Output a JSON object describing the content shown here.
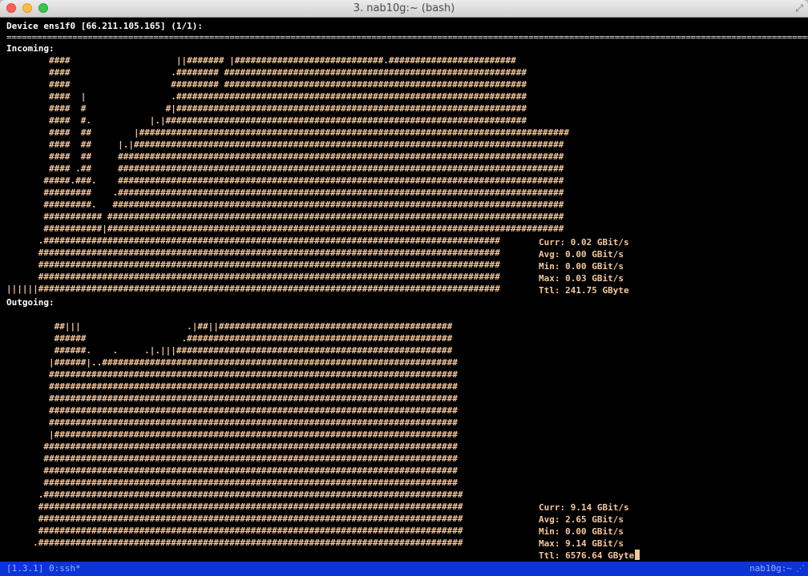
{
  "window": {
    "title": "3. nab10g:~ (bash)",
    "fullscreen_glyph": "⤢"
  },
  "terminal": {
    "header": "Device ens1f0 [66.211.105.165] (1/1):",
    "separator": "====================================================================================================================================================================",
    "incoming": {
      "label": "Incoming:",
      "graph": [
        "        ####                    ||####### |############################.########################",
        "        ####                   .######## #########################################################",
        "        ####                   ######### #########################################################",
        "        ####  |                .##################################################################",
        "        ####  #               #|##################################################################",
        "        ####  #.           |.|####################################################################",
        "        ####  ##        |#################################################################################",
        "        ####  ##     |.|#################################################################################",
        "        ####  ##     ####################################################################################",
        "        #### .##     ####################################################################################",
        "       #####.###.    ####################################################################################",
        "       #########    .####################################################################################",
        "       #########.   #####################################################################################",
        "       ########### ######################################################################################",
        "       ###########|######################################################################################",
        "      .######################################################################################",
        "      #######################################################################################",
        "      #######################################################################################",
        "      #######################################################################################",
        "||||||#######################################################################################"
      ],
      "stats": {
        "curr": "Curr: 0.02 GBit/s",
        "avg": "Avg: 0.00 GBit/s",
        "min": "Min: 0.00 GBit/s",
        "max": "Max: 0.03 GBit/s",
        "ttl": "Ttl: 241.75 GByte"
      }
    },
    "outgoing": {
      "label": "Outgoing:",
      "graph": [
        "",
        "         ##|||                    .|##||############################################",
        "         ######                  .##################################################",
        "         ######.    .     .|.|||####################################################",
        "        |######|..###################################################################",
        "        #############################################################################",
        "        #############################################################################",
        "        #############################################################################",
        "        #############################################################################",
        "        #############################################################################",
        "        |############################################################################",
        "       ##############################################################################",
        "       ##############################################################################",
        "       ##############################################################################",
        "       ##############################################################################",
        "      .###############################################################################",
        "      ################################################################################",
        "      ################################################################################",
        "      ################################################################################",
        "     .################################################################################"
      ],
      "stats": {
        "curr": "Curr: 9.14 GBit/s",
        "avg": "Avg: 2.65 GBit/s",
        "min": "Min: 0.00 GBit/s",
        "max": "Max: 9.14 GBit/s",
        "ttl": "Ttl: 6576.64 GByte"
      }
    }
  },
  "statusbar": {
    "left": "[1.3.1] 0:ssh*",
    "right": "nab10g:~",
    "resize_glyph": "⋰"
  },
  "colors": {
    "graph": "#f4c79c",
    "background": "#000000",
    "statusbar": "#0b33d8"
  }
}
